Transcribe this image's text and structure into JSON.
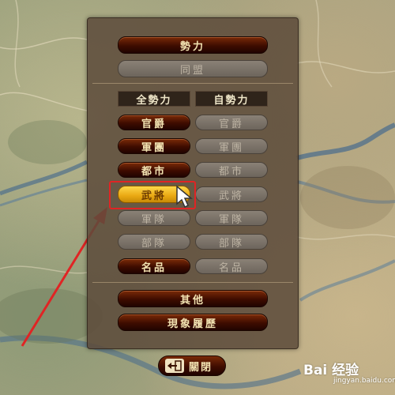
{
  "panel": {
    "top_buttons": [
      {
        "label": "勢力",
        "state": "active"
      },
      {
        "label": "同盟",
        "state": "disabled"
      }
    ],
    "columns": [
      {
        "header": "全勢力"
      },
      {
        "header": "自勢力"
      }
    ],
    "rows": [
      {
        "left": "官爵",
        "left_state": "active",
        "right": "官爵",
        "right_state": "disabled"
      },
      {
        "left": "軍團",
        "left_state": "active",
        "right": "軍團",
        "right_state": "disabled"
      },
      {
        "left": "都市",
        "left_state": "active",
        "right": "都市",
        "right_state": "disabled"
      },
      {
        "left": "武將",
        "left_state": "selected",
        "right": "武將",
        "right_state": "disabled"
      },
      {
        "left": "軍隊",
        "left_state": "disabled",
        "right": "軍隊",
        "right_state": "disabled"
      },
      {
        "left": "部隊",
        "left_state": "disabled",
        "right": "部隊",
        "right_state": "disabled"
      },
      {
        "left": "名品",
        "left_state": "active",
        "right": "名品",
        "right_state": "disabled"
      }
    ],
    "bottom_buttons": [
      {
        "label": "其他"
      },
      {
        "label": "現象履歷"
      }
    ]
  },
  "close_button": {
    "label": "關閉",
    "icon": "exit-icon"
  },
  "watermark": {
    "text": "Bai 经验",
    "sub": "jingyan.baidu.com"
  },
  "colors": {
    "dark_button": "#3e0c00",
    "selected_button": "#f0b21c",
    "disabled_button": "#7a7268",
    "annotation": "#e02424"
  }
}
